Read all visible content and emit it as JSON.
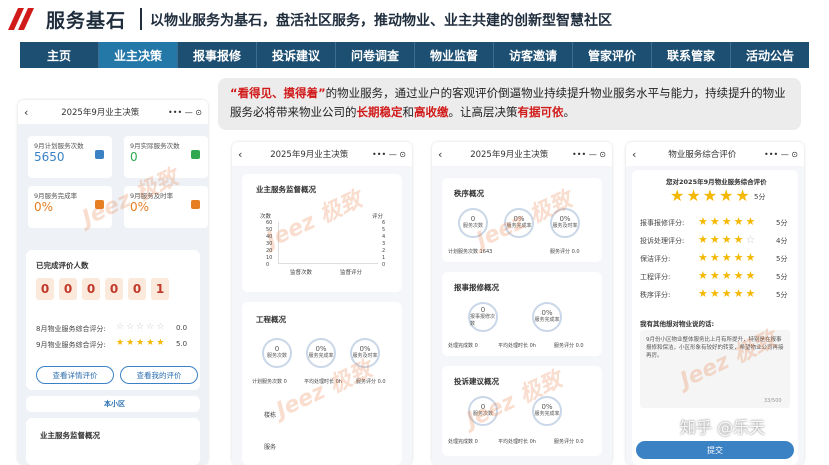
{
  "header": {
    "title": "服务基石",
    "subtitle": "以物业服务为基石，盘活社区服务，推动物业、业主共建的创新型智慧社区"
  },
  "nav": {
    "items": [
      {
        "label": "主页"
      },
      {
        "label": "业主决策",
        "active": true
      },
      {
        "label": "报事报修"
      },
      {
        "label": "投诉建议"
      },
      {
        "label": "问卷调查"
      },
      {
        "label": "物业监督"
      },
      {
        "label": "访客邀请"
      },
      {
        "label": "管家评价"
      },
      {
        "label": "联系管家"
      },
      {
        "label": "活动公告"
      }
    ]
  },
  "quote": {
    "q_open": "“",
    "hl1": "看得见、摸得着",
    "q_close": "”",
    "t1": "的物业服务，通过业户的客观评价倒逼物业持续提升物业服务水平与能力，持续提升的物业服务必将带来物业公司的",
    "hl2": "长期稳定",
    "t2": "和",
    "hl3": "高收缴",
    "t3": "。让高层决策",
    "hl4": "有据可依",
    "t4": "。"
  },
  "phone1": {
    "title": "2025年9月业主决策",
    "capsule": "•••  —  ⊙",
    "stats": [
      {
        "label": "9月计划服务次数",
        "value": "5650"
      },
      {
        "label": "9月实际服务次数",
        "value": "0"
      },
      {
        "label": "9月服务完成率",
        "value": "0%"
      },
      {
        "label": "9月服务及时率",
        "value": "0%"
      }
    ],
    "eval_title": "已完成评价人数",
    "digits": [
      "0",
      "0",
      "0",
      "0",
      "0",
      "1"
    ],
    "score8_label": "8月物业服务综合评分:",
    "score8_value": "0.0",
    "score9_label": "9月物业服务综合评分:",
    "score9_value": "5.0",
    "btn_detail": "查看详情评价",
    "btn_mine": "查看我的评价",
    "community": "本小区",
    "section_title": "业主服务监督概况"
  },
  "phone2": {
    "title": "2025年9月业主决策",
    "capsule": "•••  —  ⊙",
    "chart_title": "业主服务监督概况",
    "axis_left_label": "次数",
    "axis_right_label": "评分",
    "left_ticks": [
      "60",
      "50",
      "40",
      "30",
      "20",
      "10",
      "0"
    ],
    "right_ticks": [
      "6",
      "5",
      "4",
      "3",
      "2",
      "1",
      "0"
    ],
    "x_labels": [
      "监督次数",
      "监督评分"
    ],
    "work_title": "工程概况",
    "work_circles": [
      {
        "value": "0",
        "label": "服务次数"
      },
      {
        "value": "0%",
        "label": "服务完成率"
      },
      {
        "value": "0%",
        "label": "服务及时率"
      }
    ],
    "work_stats": [
      "计划服务次数  0",
      "平均处理时长  0h",
      "服务评分  0.0"
    ],
    "rows": [
      "楼栋",
      "服务"
    ]
  },
  "phone3": {
    "title": "2025年9月业主决策",
    "capsule": "•••  —  ⊙",
    "s1_title": "秩序概况",
    "s1_circles": [
      {
        "value": "0",
        "label": "服务次数"
      },
      {
        "value": "0%",
        "label": "服务完成率"
      },
      {
        "value": "0%",
        "label": "服务及时率"
      }
    ],
    "s1_stats": [
      "计划服务次数  1643",
      "服务评分  0.0"
    ],
    "s2_title": "报事报修概况",
    "s2_circles": [
      {
        "value": "0",
        "label": "报事报修次数"
      },
      {
        "value": "0%",
        "label": "服务完成率"
      }
    ],
    "s2_stats": [
      "处理完成数  0",
      "平均处理时长  0h",
      "服务评分  0.0"
    ],
    "s3_title": "投诉建议概况",
    "s3_circles": [
      {
        "value": "0",
        "label": "服务次数"
      },
      {
        "value": "0%",
        "label": "服务完成率"
      }
    ],
    "s3_stats": [
      "处理完成数  0",
      "平均处理时长  0h",
      "服务评分  0.0"
    ]
  },
  "phone4": {
    "title": "物业服务综合评价",
    "capsule": "•••  —  ⊙",
    "heading": "您对2025年9月物业服务综合评价",
    "overall_score": "5分",
    "items": [
      {
        "label": "报事报修评分:",
        "score": "5分",
        "stars": 5
      },
      {
        "label": "投诉处理评分:",
        "score": "4分",
        "stars": 4
      },
      {
        "label": "保洁评分:",
        "score": "5分",
        "stars": 5
      },
      {
        "label": "工程评分:",
        "score": "5分",
        "stars": 5
      },
      {
        "label": "秩序评分:",
        "score": "5分",
        "stars": 5
      }
    ],
    "comment_label": "我有其他想对物业说的话:",
    "comment_text": "9月份小区物业整体服务比上月有所提升，特别是在报事报修和保洁，小区形象有较好的转变，希望物业公司再接再厉。",
    "counter": "33/500",
    "submit": "提交"
  },
  "watermark": "Jeez 极致",
  "credit": "知乎 @乐天",
  "colors": {
    "nav_bg": "#1d4f72",
    "nav_active": "#2478a8",
    "highlight_red": "#d11a1a",
    "star": "#f5b800",
    "primary_blue": "#3b82c4"
  }
}
